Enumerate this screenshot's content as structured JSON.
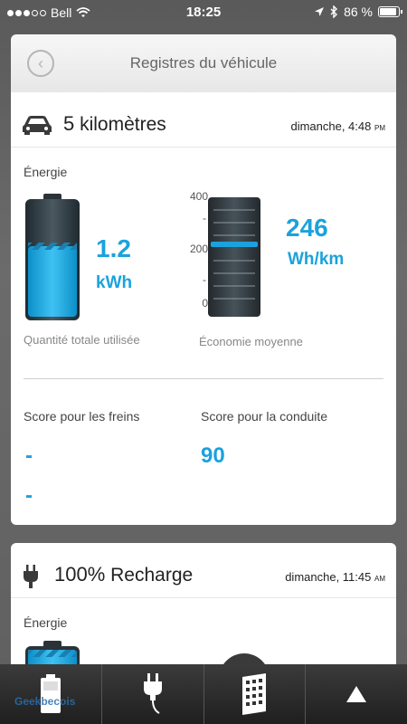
{
  "status_bar": {
    "carrier": "Bell",
    "time": "18:25",
    "battery_percent": "86 %",
    "signal_bars_filled": 3,
    "signal_bars_total": 5
  },
  "header": {
    "title": "Registres du véhicule"
  },
  "trip": {
    "distance": "5",
    "unit": "kilomètres",
    "date": "dimanche, 4:48",
    "ampm": "PM",
    "energy_label": "Énergie",
    "energy_value": "1.2",
    "energy_unit": "kWh",
    "battery_fill_fraction": 0.6,
    "total_label": "Quantité totale utilisée",
    "gauge_ticks": [
      "400",
      "200",
      "0"
    ],
    "gauge_max": 400,
    "gauge_value": 246,
    "efficiency_value": "246",
    "efficiency_unit": "Wh/km",
    "economy_label": "Économie moyenne",
    "brake_label": "Score pour les freins",
    "brake_value_1": "-",
    "brake_value_2": "-",
    "drive_label": "Score pour la conduite",
    "drive_value": "90"
  },
  "charge": {
    "percent": "100%",
    "label": "Recharge",
    "date": "dimanche, 11:45",
    "ampm": "AM",
    "energy_label": "Énergie"
  },
  "tabbar": {
    "watermark": "Geekbecois",
    "tabs": [
      "battery-icon",
      "plug-icon",
      "remote-icon",
      "up-arrow-icon"
    ]
  },
  "colors": {
    "accent": "#1ba2dd",
    "card_bg": "#ffffff",
    "tabbar_bg": "#2a2a2a"
  }
}
